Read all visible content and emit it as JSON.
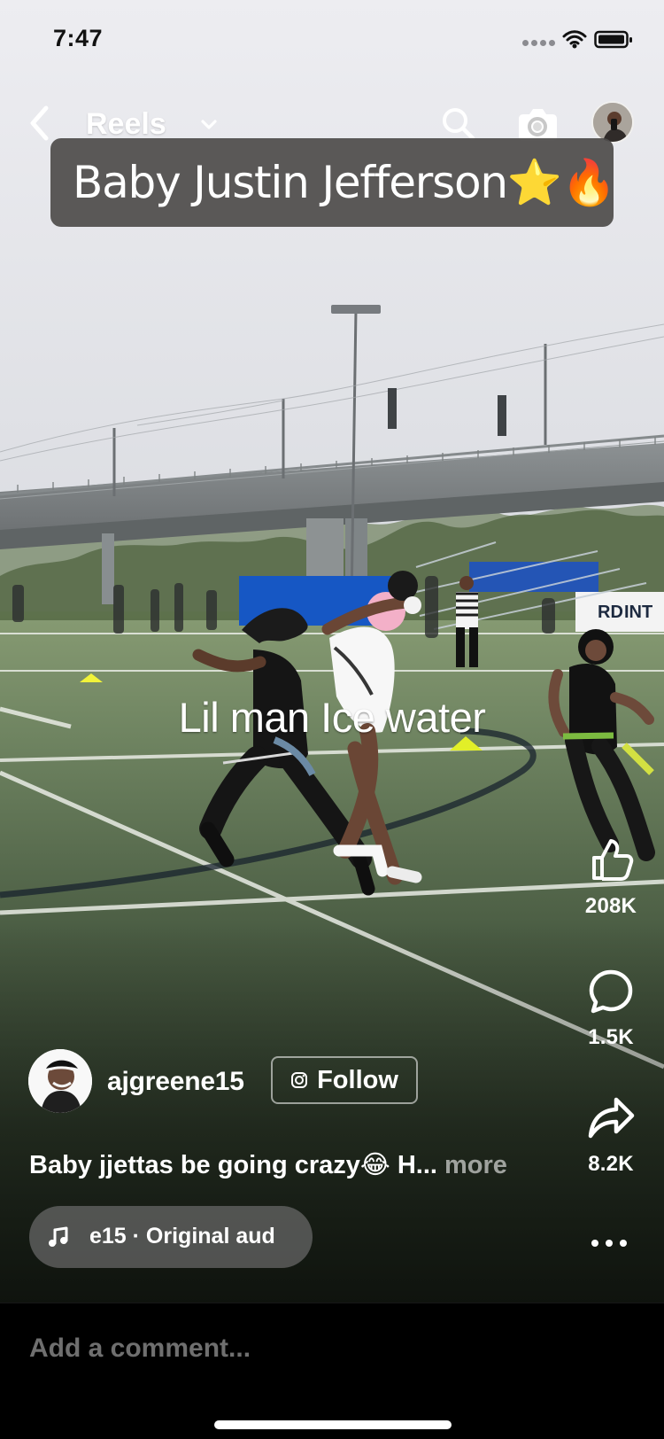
{
  "status_bar": {
    "time": "7:47",
    "icons": [
      "signal-dots-icon",
      "wifi-icon",
      "battery-icon"
    ]
  },
  "header": {
    "title": "Reels",
    "icons": [
      "back-icon",
      "chevron-down-icon",
      "search-icon",
      "camera-icon",
      "profile-avatar"
    ]
  },
  "video": {
    "caption_overlay": "Baby Justin Jefferson⭐️🔥",
    "on_video_text": "Lil man Ice water"
  },
  "actions": {
    "like_count": "208K",
    "comment_count": "1.5K",
    "share_count": "8.2K",
    "icons": [
      "thumbs-up-icon",
      "comment-bubble-icon",
      "share-arrow-icon",
      "more-horizontal-icon"
    ]
  },
  "creator": {
    "username": "ajgreene15",
    "follow_label": "Follow",
    "follow_icon": "instagram-icon"
  },
  "post": {
    "caption": "Baby jjettas be going crazy😂 H...",
    "more_label": "more"
  },
  "audio": {
    "track_text": "e15 · Original aud",
    "icon": "music-note-icon"
  },
  "comment": {
    "placeholder": "Add a comment..."
  },
  "colors": {
    "overlay_box": "#4f4c4b",
    "follow_border": "#ffffff",
    "comment_placeholder": "#6f6f6f"
  }
}
